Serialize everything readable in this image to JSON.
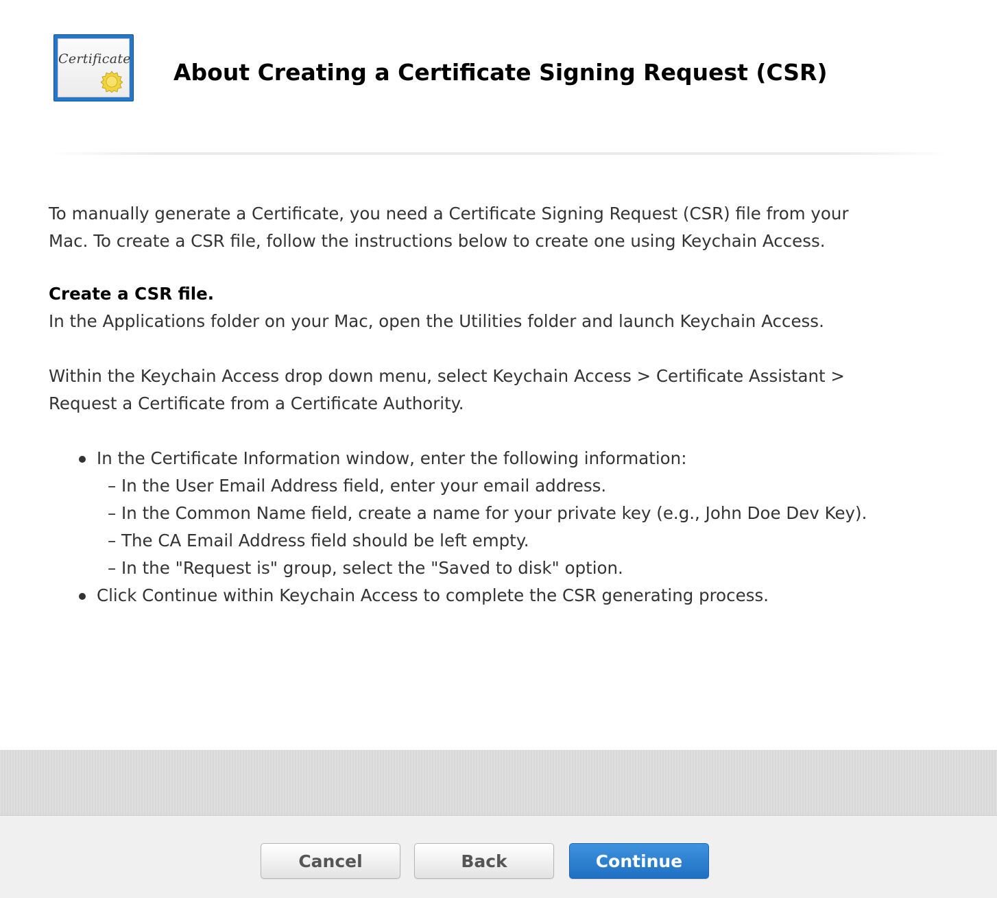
{
  "header": {
    "icon_label": "Certificate",
    "title": "About Creating a Certificate Signing Request (CSR)"
  },
  "intro": [
    "To manually generate a Certificate, you need a Certificate Signing Request (CSR) file from your",
    "Mac. To create a CSR file, follow the instructions below to create one using Keychain Access."
  ],
  "section": {
    "heading": "Create a CSR file.",
    "step1": "In the Applications folder on your Mac, open the Utilities folder and launch Keychain Access.",
    "step2": [
      "Within the Keychain Access drop down menu, select Keychain Access > Certificate Assistant >",
      "Request a Certificate from a Certificate Authority."
    ]
  },
  "bullets": [
    {
      "text": "In the Certificate Information window, enter the following information:",
      "subitems": [
        "– In the User Email Address field, enter your email address.",
        "– In the Common Name field, create a name for your private key (e.g., John Doe Dev Key).",
        "– The CA Email Address field should be left empty.",
        "– In the \"Request is\" group, select the \"Saved to disk\" option."
      ]
    },
    {
      "text": "Click Continue within Keychain Access to complete the CSR generating process.",
      "subitems": []
    }
  ],
  "buttons": {
    "cancel": "Cancel",
    "back": "Back",
    "continue": "Continue"
  },
  "colors": {
    "primary_button": "#2a7fd1",
    "icon_frame": "#2677c7",
    "seal": "#e8c830"
  },
  "icons": {
    "certificate": "certificate-icon",
    "seal": "seal-icon"
  }
}
